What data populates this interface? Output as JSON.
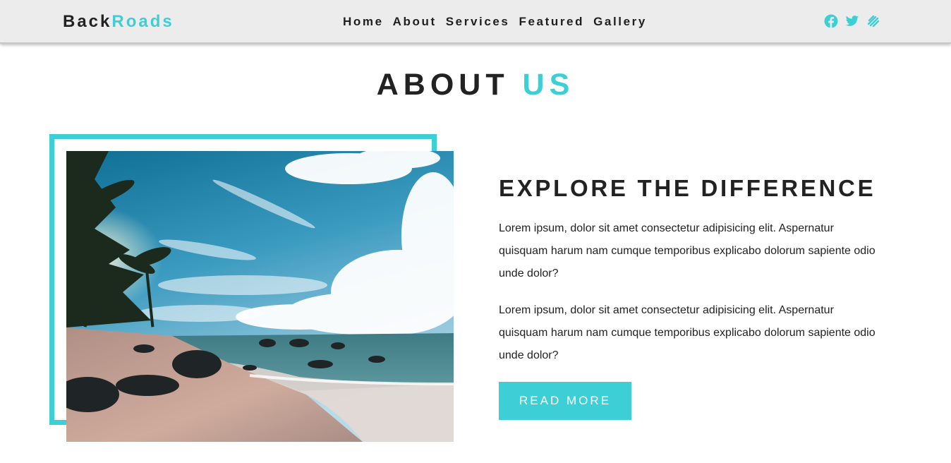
{
  "brand": {
    "part1": "Back",
    "part2": "Roads"
  },
  "nav": {
    "links": [
      "Home",
      "About",
      "Services",
      "Featured",
      "Gallery"
    ]
  },
  "social": [
    "facebook-icon",
    "twitter-icon",
    "squarespace-icon"
  ],
  "section": {
    "title_part1": "ABOUT",
    "title_part2": "US"
  },
  "about": {
    "heading": "EXPLORE THE DIFFERENCE",
    "paragraph1": "Lorem ipsum, dolor sit amet consectetur adipisicing elit. Aspernatur quisquam harum nam cumque temporibus explicabo dolorum sapiente odio unde dolor?",
    "paragraph2": "Lorem ipsum, dolor sit amet consectetur adipisicing elit. Aspernatur quisquam harum nam cumque temporibus explicabo dolorum sapiente odio unde dolor?",
    "button_label": "READ MORE"
  },
  "colors": {
    "accent": "#3ccfd5",
    "navbar_bg": "#ececec",
    "text": "#222222"
  }
}
